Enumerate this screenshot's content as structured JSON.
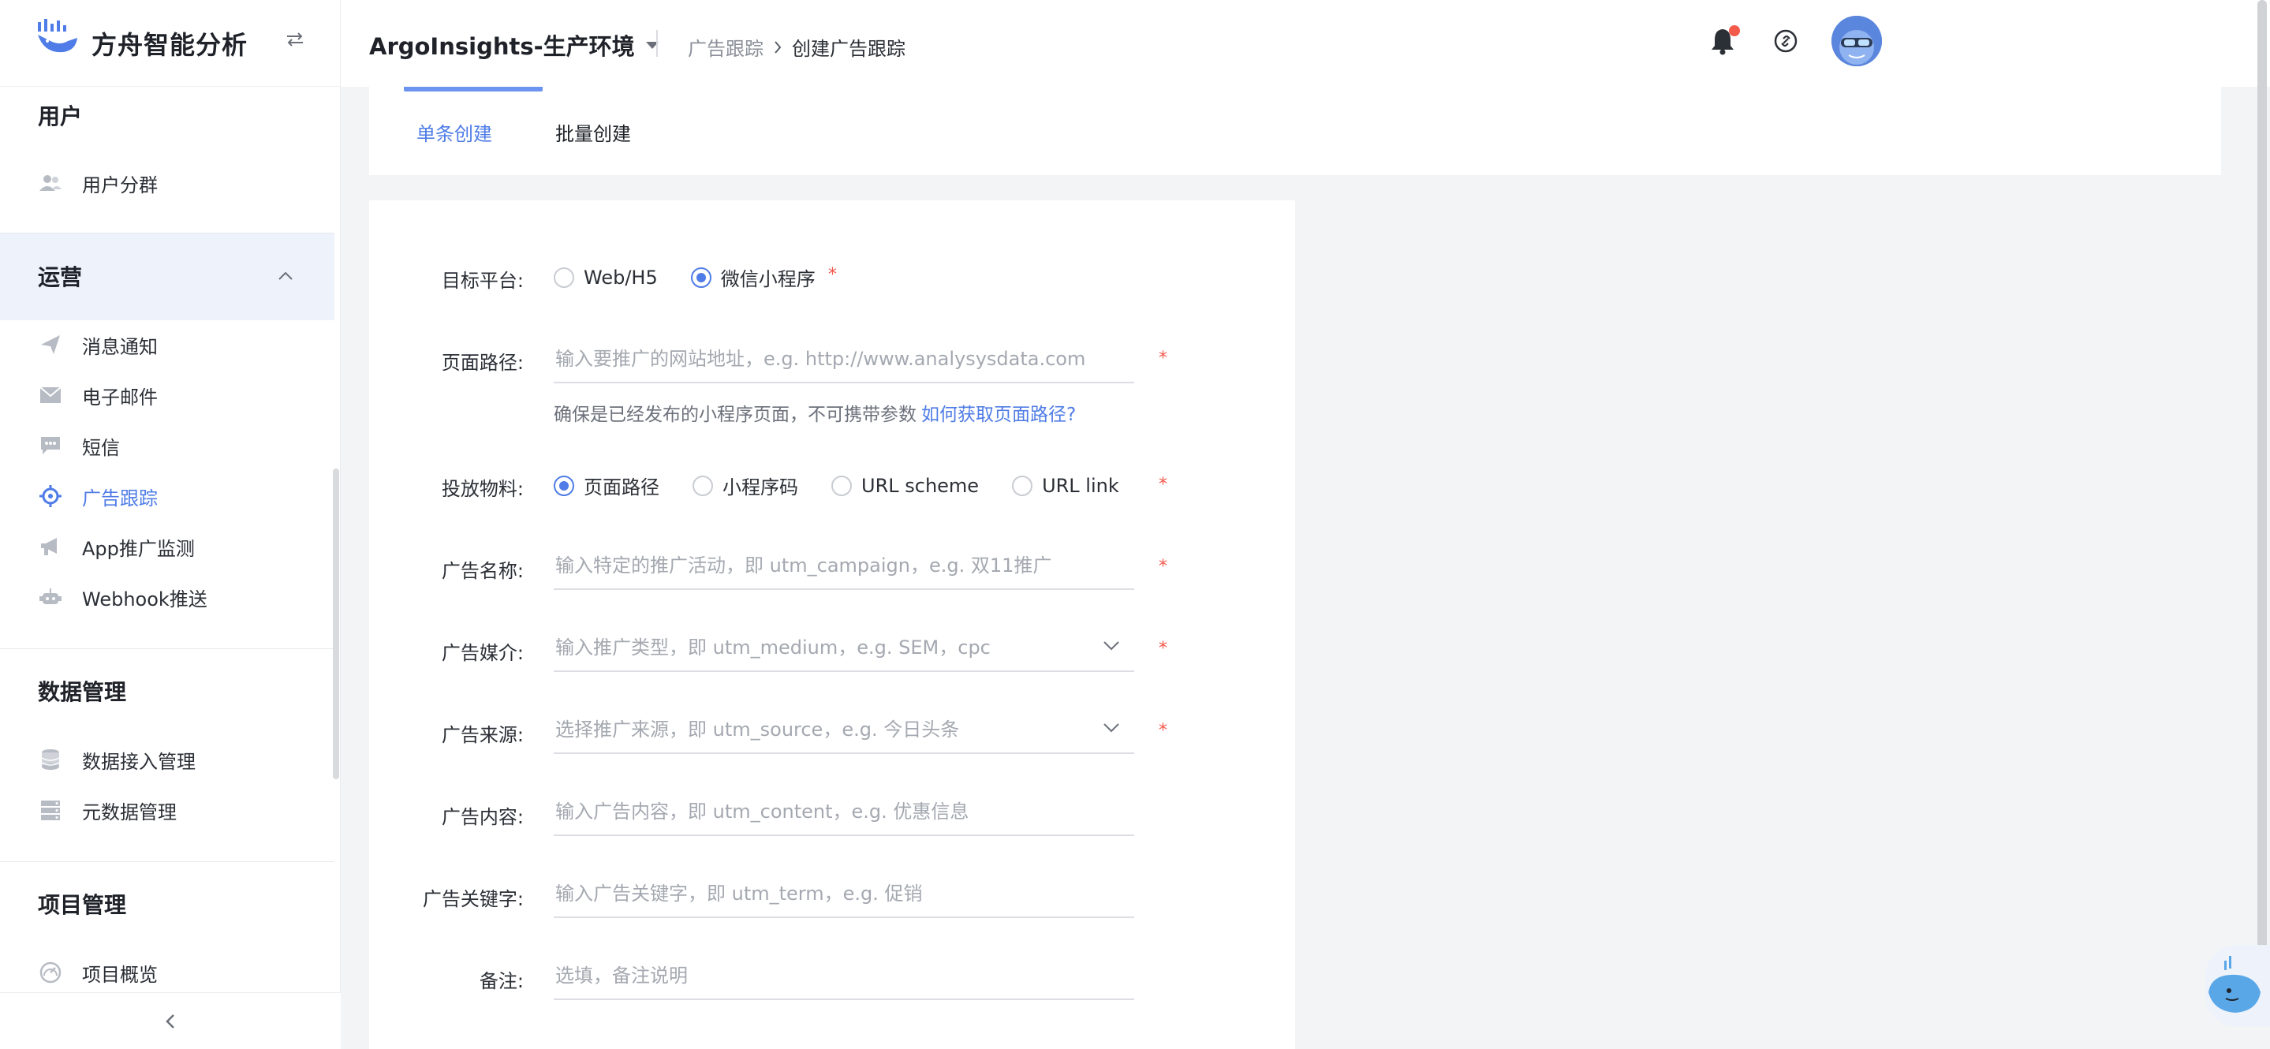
{
  "brand": {
    "name": "方舟智能分析"
  },
  "sidebar": {
    "section_user": "用户",
    "item_user_segments": "用户分群",
    "section_ops": "运营",
    "ops_items": [
      {
        "label": "消息通知",
        "icon": "paper-plane-icon"
      },
      {
        "label": "电子邮件",
        "icon": "envelope-icon"
      },
      {
        "label": "短信",
        "icon": "chat-bubble-icon"
      },
      {
        "label": "广告跟踪",
        "icon": "crosshair-icon",
        "active": true
      },
      {
        "label": "App推广监测",
        "icon": "megaphone-icon"
      },
      {
        "label": "Webhook推送",
        "icon": "robot-icon"
      }
    ],
    "section_data": "数据管理",
    "data_items": [
      {
        "label": "数据接入管理",
        "icon": "database-icon"
      },
      {
        "label": "元数据管理",
        "icon": "server-icon"
      }
    ],
    "section_project": "项目管理",
    "project_items": [
      {
        "label": "项目概览",
        "icon": "gauge-icon"
      }
    ]
  },
  "header": {
    "project": "ArgoInsights-生产环境",
    "breadcrumb_prev": "广告跟踪",
    "breadcrumb_current": "创建广告跟踪"
  },
  "tabs": {
    "single": "单条创建",
    "batch": "批量创建"
  },
  "form": {
    "platform": {
      "label": "目标平台:",
      "options": [
        "Web/H5",
        "微信小程序"
      ],
      "selected": "微信小程序"
    },
    "page_path": {
      "label": "页面路径:",
      "placeholder": "输入要推广的网站地址，e.g. http://www.analysysdata.com",
      "hint": "确保是已经发布的小程序页面，不可携带参数",
      "hint_link": "如何获取页面路径?"
    },
    "material": {
      "label": "投放物料:",
      "options": [
        "页面路径",
        "小程序码",
        "URL scheme",
        "URL link"
      ],
      "selected": "页面路径"
    },
    "campaign": {
      "label": "广告名称:",
      "placeholder": "输入特定的推广活动，即 utm_campaign，e.g. 双11推广"
    },
    "medium": {
      "label": "广告媒介:",
      "placeholder": "输入推广类型，即 utm_medium，e.g. SEM，cpc"
    },
    "source": {
      "label": "广告来源:",
      "placeholder": "选择推广来源，即 utm_source，e.g. 今日头条"
    },
    "content": {
      "label": "广告内容:",
      "placeholder": "输入广告内容，即 utm_content，e.g. 优惠信息"
    },
    "term": {
      "label": "广告关键字:",
      "placeholder": "输入广告关键字，即 utm_term，e.g. 促销"
    },
    "note": {
      "label": "备注:",
      "placeholder": "选填，备注说明"
    },
    "required_mark": "*"
  },
  "colors": {
    "accent": "#4f7ce6",
    "required": "#f2574a",
    "notify_dot": "#f25a4a"
  }
}
